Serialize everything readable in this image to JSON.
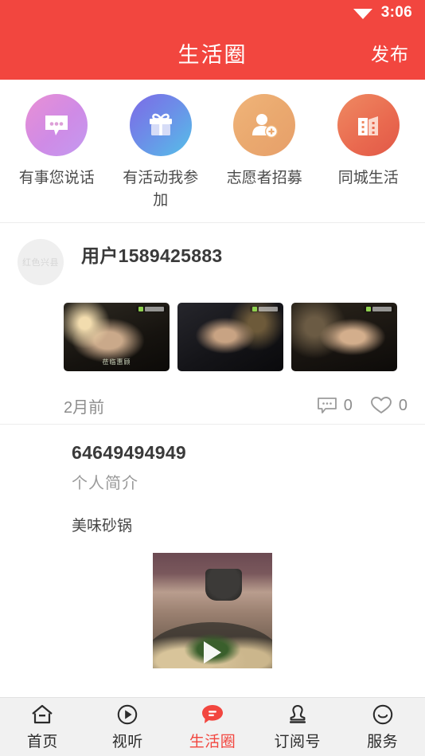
{
  "statusbar": {
    "wifi_icon": "wifi-icon",
    "time": "3:06"
  },
  "header": {
    "title": "生活圈",
    "action_label": "发布",
    "bg_color": "#F2463F"
  },
  "categories": [
    {
      "label": "有事您说话",
      "icon": "chat-bubble-icon",
      "gradient": "#e98fd4 → #c39af0"
    },
    {
      "label": "有活动我参加",
      "icon": "gift-icon",
      "gradient": "#7d6ae6 → #55c0e8"
    },
    {
      "label": "志愿者招募",
      "icon": "person-add-icon",
      "gradient": "#f0b479 → #e79f6a"
    },
    {
      "label": "同城生活",
      "icon": "building-icon",
      "gradient": "#ef8a62 → #e15847"
    }
  ],
  "posts": [
    {
      "avatar_watermark": "红色兴县",
      "user": "用户1589425883",
      "subtitle": "",
      "body": "",
      "thumbnails": [
        {
          "caption": "莅临惠顾"
        },
        {
          "caption": ""
        },
        {
          "caption": ""
        }
      ],
      "time": "2月前",
      "comment_icon": "comment-icon",
      "comment_count": "0",
      "like_icon": "heart-icon",
      "like_count": "0"
    },
    {
      "avatar_watermark": "",
      "user": "64649494949",
      "subtitle": "个人简介",
      "body": "美味砂锅",
      "video": {
        "play_icon": "play-icon"
      }
    }
  ],
  "tabbar": {
    "active_color": "#F2463F",
    "items": [
      {
        "label": "首页",
        "icon": "home-icon",
        "active": false
      },
      {
        "label": "视听",
        "icon": "play-circle-icon",
        "active": false
      },
      {
        "label": "生活圈",
        "icon": "chat-bubble-filled-icon",
        "active": true
      },
      {
        "label": "订阅号",
        "icon": "stamp-icon",
        "active": false
      },
      {
        "label": "服务",
        "icon": "smiley-icon",
        "active": false
      }
    ]
  }
}
